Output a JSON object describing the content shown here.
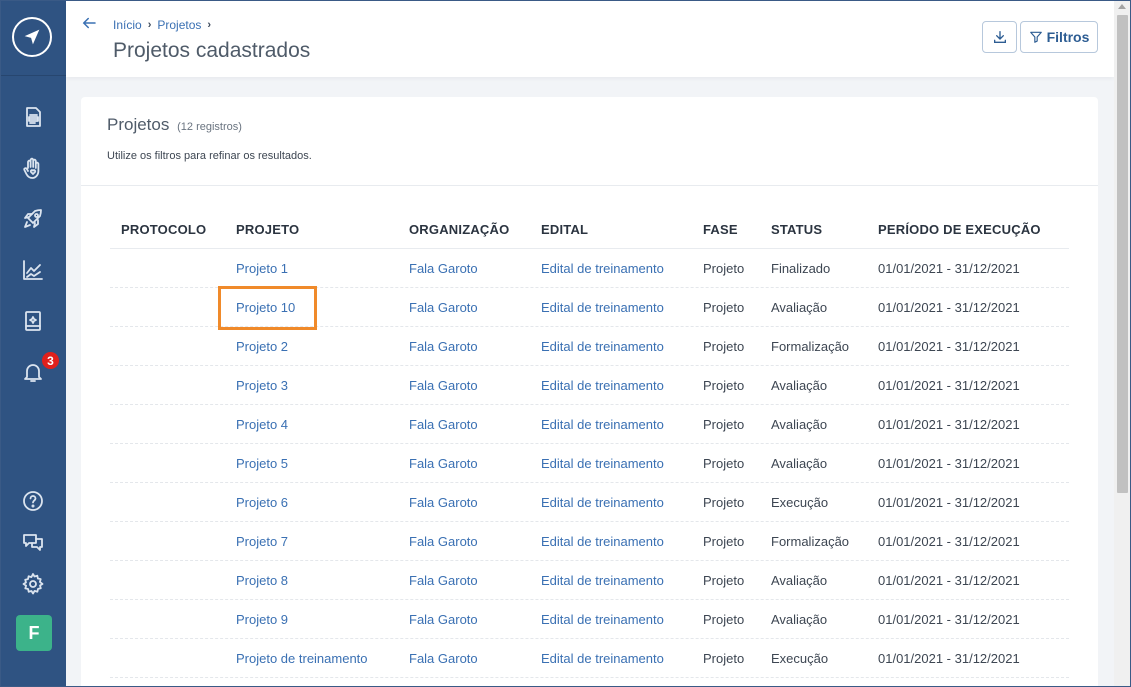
{
  "sidebar": {
    "notification_count": "3",
    "avatar_initial": "F"
  },
  "header": {
    "breadcrumb": [
      "Início",
      "Projetos"
    ],
    "title": "Projetos cadastrados",
    "filters_label": "Filtros"
  },
  "card": {
    "title": "Projetos",
    "count": "(12 registros)",
    "subtitle": "Utilize os filtros para refinar os resultados."
  },
  "table": {
    "columns": [
      "PROTOCOLO",
      "PROJETO",
      "ORGANIZAÇÃO",
      "EDITAL",
      "FASE",
      "STATUS",
      "PERÍODO DE EXECUÇÃO"
    ],
    "rows": [
      {
        "protocolo": "",
        "projeto": "Projeto 1",
        "organizacao": "Fala Garoto",
        "edital": "Edital de treinamento",
        "fase": "Projeto",
        "status": "Finalizado",
        "periodo": "01/01/2021 - 31/12/2021"
      },
      {
        "protocolo": "",
        "projeto": "Projeto 10",
        "organizacao": "Fala Garoto",
        "edital": "Edital de treinamento",
        "fase": "Projeto",
        "status": "Avaliação",
        "periodo": "01/01/2021 - 31/12/2021"
      },
      {
        "protocolo": "",
        "projeto": "Projeto 2",
        "organizacao": "Fala Garoto",
        "edital": "Edital de treinamento",
        "fase": "Projeto",
        "status": "Formalização",
        "periodo": "01/01/2021 - 31/12/2021"
      },
      {
        "protocolo": "",
        "projeto": "Projeto 3",
        "organizacao": "Fala Garoto",
        "edital": "Edital de treinamento",
        "fase": "Projeto",
        "status": "Avaliação",
        "periodo": "01/01/2021 - 31/12/2021"
      },
      {
        "protocolo": "",
        "projeto": "Projeto 4",
        "organizacao": "Fala Garoto",
        "edital": "Edital de treinamento",
        "fase": "Projeto",
        "status": "Avaliação",
        "periodo": "01/01/2021 - 31/12/2021"
      },
      {
        "protocolo": "",
        "projeto": "Projeto 5",
        "organizacao": "Fala Garoto",
        "edital": "Edital de treinamento",
        "fase": "Projeto",
        "status": "Avaliação",
        "periodo": "01/01/2021 - 31/12/2021"
      },
      {
        "protocolo": "",
        "projeto": "Projeto 6",
        "organizacao": "Fala Garoto",
        "edital": "Edital de treinamento",
        "fase": "Projeto",
        "status": "Execução",
        "periodo": "01/01/2021 - 31/12/2021"
      },
      {
        "protocolo": "",
        "projeto": "Projeto 7",
        "organizacao": "Fala Garoto",
        "edital": "Edital de treinamento",
        "fase": "Projeto",
        "status": "Formalização",
        "periodo": "01/01/2021 - 31/12/2021"
      },
      {
        "protocolo": "",
        "projeto": "Projeto 8",
        "organizacao": "Fala Garoto",
        "edital": "Edital de treinamento",
        "fase": "Projeto",
        "status": "Avaliação",
        "periodo": "01/01/2021 - 31/12/2021"
      },
      {
        "protocolo": "",
        "projeto": "Projeto 9",
        "organizacao": "Fala Garoto",
        "edital": "Edital de treinamento",
        "fase": "Projeto",
        "status": "Avaliação",
        "periodo": "01/01/2021 - 31/12/2021"
      },
      {
        "protocolo": "",
        "projeto": "Projeto de treinamento",
        "organizacao": "Fala Garoto",
        "edital": "Edital de treinamento",
        "fase": "Projeto",
        "status": "Execução",
        "periodo": "01/01/2021 - 31/12/2021"
      }
    ]
  },
  "colors": {
    "sidebar_bg": "#2f5382",
    "link": "#3a70b3",
    "highlight": "#f08a2a",
    "badge": "#e0201c",
    "avatar": "#3cb38a"
  },
  "icons": {
    "logo": "paper-plane-icon",
    "sidebar": [
      "document-icon",
      "hand-heart-icon",
      "rocket-icon",
      "chart-line-icon",
      "book-icon",
      "bell-icon",
      "help-icon",
      "chat-icon",
      "gear-icon"
    ]
  }
}
